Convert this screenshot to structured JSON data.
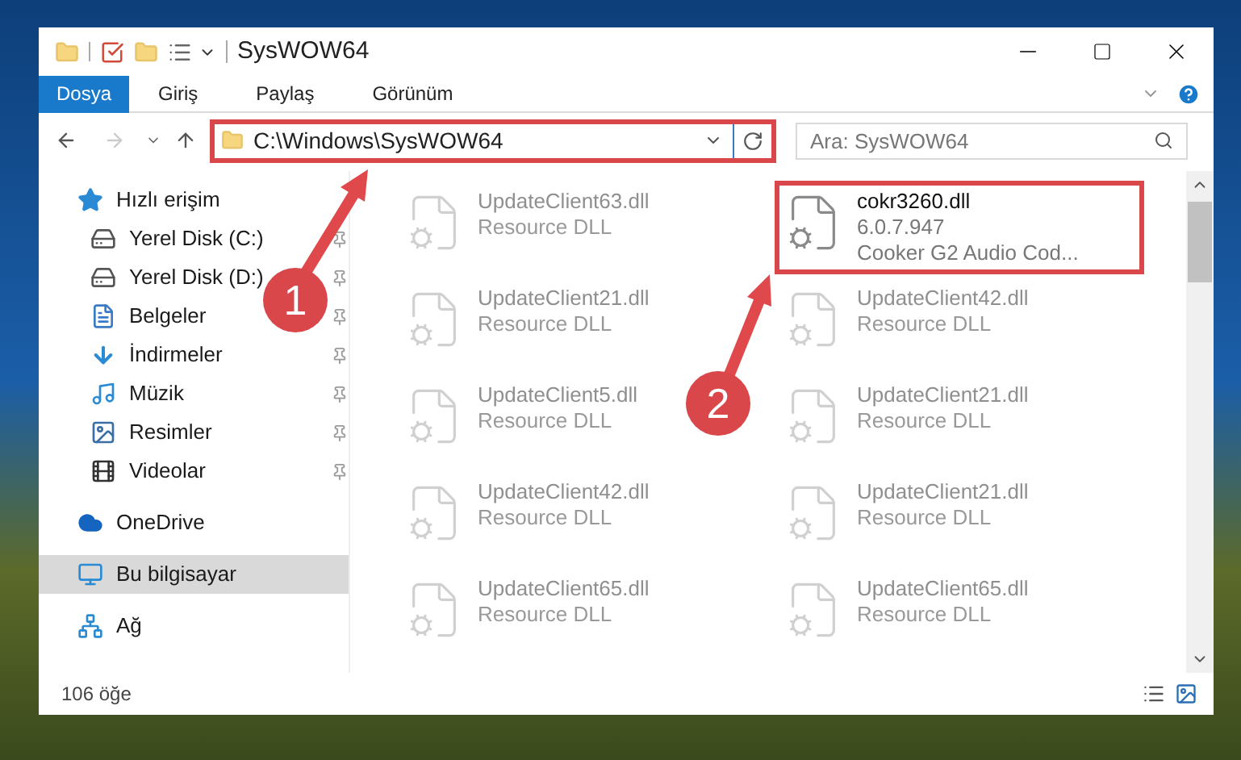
{
  "window": {
    "title": "SysWOW64"
  },
  "ribbon_tabs": [
    {
      "label": "Dosya",
      "kind": "file"
    },
    {
      "label": "Giriş",
      "kind": "tab"
    },
    {
      "label": "Paylaş",
      "kind": "tab"
    },
    {
      "label": "Görünüm",
      "kind": "tab"
    }
  ],
  "address": {
    "path": "C:\\Windows\\SysWOW64"
  },
  "search": {
    "placeholder": "Ara: SysWOW64"
  },
  "sidebar": {
    "items": [
      {
        "label": "Hızlı erişim",
        "kind": "star",
        "selected": false,
        "children": [
          {
            "label": "Yerel Disk (C:)",
            "kind": "drive",
            "pinned": true,
            "selected": false
          },
          {
            "label": "Yerel Disk (D:)",
            "kind": "drive",
            "pinned": true,
            "selected": false
          },
          {
            "label": "Belgeler",
            "kind": "documents",
            "pinned": true,
            "selected": false
          },
          {
            "label": "İndirmeler",
            "kind": "downloads",
            "pinned": true,
            "selected": false
          },
          {
            "label": "Müzik",
            "kind": "music",
            "pinned": true,
            "selected": false
          },
          {
            "label": "Resimler",
            "kind": "pictures",
            "pinned": true,
            "selected": false
          },
          {
            "label": "Videolar",
            "kind": "videos",
            "pinned": true,
            "selected": false
          }
        ]
      },
      {
        "label": "OneDrive",
        "kind": "cloud",
        "selected": false
      },
      {
        "label": "Bu bilgisayar",
        "kind": "computer",
        "selected": true
      },
      {
        "label": "Ağ",
        "kind": "network",
        "selected": false
      }
    ]
  },
  "files": [
    {
      "name": "UpdateClient63.dll",
      "description": "Resource DLL",
      "dimmed": true,
      "highlighted": false
    },
    {
      "name": "cokr3260.dll",
      "version": "6.0.7.947",
      "description": "Cooker G2 Audio Cod...",
      "dimmed": false,
      "highlighted": true
    },
    {
      "name": "UpdateClient21.dll",
      "description": "Resource DLL",
      "dimmed": true,
      "highlighted": false
    },
    {
      "name": "UpdateClient42.dll",
      "description": "Resource DLL",
      "dimmed": true,
      "highlighted": false
    },
    {
      "name": "UpdateClient5.dll",
      "description": "Resource DLL",
      "dimmed": true,
      "highlighted": false
    },
    {
      "name": "UpdateClient21.dll",
      "description": "Resource DLL",
      "dimmed": true,
      "highlighted": false
    },
    {
      "name": "UpdateClient42.dll",
      "description": "Resource DLL",
      "dimmed": true,
      "highlighted": false
    },
    {
      "name": "UpdateClient21.dll",
      "description": "Resource DLL",
      "dimmed": true,
      "highlighted": false
    },
    {
      "name": "UpdateClient65.dll",
      "description": "Resource DLL",
      "dimmed": true,
      "highlighted": false
    },
    {
      "name": "UpdateClient65.dll",
      "description": "Resource DLL",
      "dimmed": true,
      "highlighted": false
    }
  ],
  "status_bar": {
    "count": "106 öğe"
  },
  "annotations": [
    {
      "label": "1"
    },
    {
      "label": "2"
    }
  ]
}
